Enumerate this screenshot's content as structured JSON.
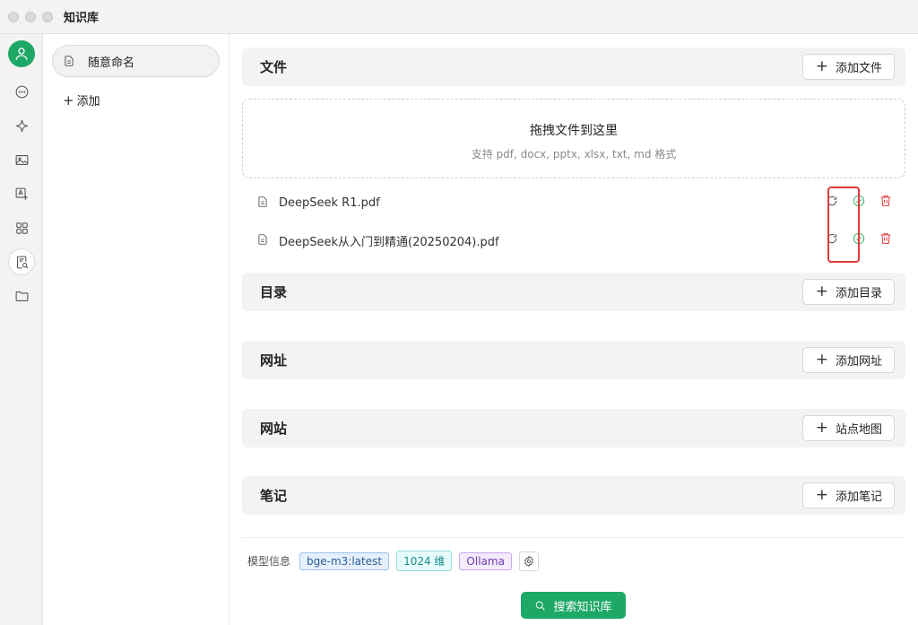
{
  "window": {
    "title": "知识库"
  },
  "colors": {
    "accent": "#1ea866",
    "danger": "#e23a3a",
    "highlight_box": "#e23a3a"
  },
  "iconbar": {
    "items": [
      {
        "name": "avatar",
        "icon": "user-icon"
      },
      {
        "name": "chat",
        "icon": "chat-bubble-icon"
      },
      {
        "name": "assistant",
        "icon": "sparkle-icon"
      },
      {
        "name": "images",
        "icon": "image-icon"
      },
      {
        "name": "translate",
        "icon": "translate-icon"
      },
      {
        "name": "apps",
        "icon": "grid-icon"
      },
      {
        "name": "knowledge",
        "icon": "knowledge-search-icon",
        "active": true
      },
      {
        "name": "files",
        "icon": "folder-icon"
      }
    ]
  },
  "kb_list": {
    "items": [
      {
        "label": "随意命名",
        "icon": "document-icon",
        "selected": true
      }
    ],
    "add_label": "添加"
  },
  "sections": {
    "files": {
      "title": "文件",
      "button": "添加文件"
    },
    "directory": {
      "title": "目录",
      "button": "添加目录"
    },
    "url": {
      "title": "网址",
      "button": "添加网址"
    },
    "website": {
      "title": "网站",
      "button": "站点地图"
    },
    "notes": {
      "title": "笔记",
      "button": "添加笔记"
    }
  },
  "dropzone": {
    "title": "拖拽文件到这里",
    "subtitle": "支持 pdf, docx, pptx, xlsx, txt, md 格式"
  },
  "files": [
    {
      "name": "DeepSeek R1.pdf",
      "status": "done"
    },
    {
      "name": "DeepSeek从入门到精通(20250204).pdf",
      "status": "done"
    }
  ],
  "model_info": {
    "label": "模型信息",
    "model": "bge-m3:latest",
    "dimensions": "1024 维",
    "provider": "Ollama"
  },
  "search_button": "搜索知识库"
}
